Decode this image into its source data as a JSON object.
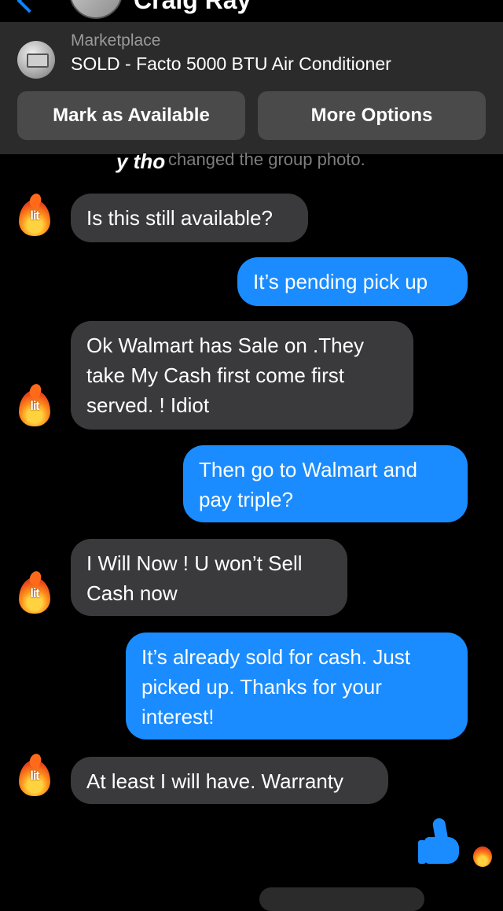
{
  "header": {
    "contact_name": "Craig Ray"
  },
  "marketplace": {
    "label": "Marketplace",
    "title": "SOLD - Facto 5000 BTU Air Conditioner",
    "buttons": {
      "mark_available": "Mark as Available",
      "more_options": "More Options"
    }
  },
  "system": {
    "text": "changed the group photo.",
    "sticker": "y tho"
  },
  "avatar_emoji": "lit",
  "messages": [
    {
      "from": "them",
      "text": "Is this still available?"
    },
    {
      "from": "me",
      "text": "It’s pending pick up"
    },
    {
      "from": "them",
      "text": "Ok Walmart has Sale on .They take My Cash first come first served. ! Idiot"
    },
    {
      "from": "me",
      "text": "Then go to Walmart and pay triple?"
    },
    {
      "from": "them",
      "text": "I Will Now ! U won’t Sell Cash now"
    },
    {
      "from": "me",
      "text": "It’s already sold for cash. Just picked up. Thanks for your interest!"
    },
    {
      "from": "them",
      "text": "At least I will have. Warranty"
    }
  ],
  "colors": {
    "outgoing": "#1a8cff",
    "incoming": "#3a3a3c",
    "card": "#2b2b2b",
    "accent": "#0a84ff"
  }
}
